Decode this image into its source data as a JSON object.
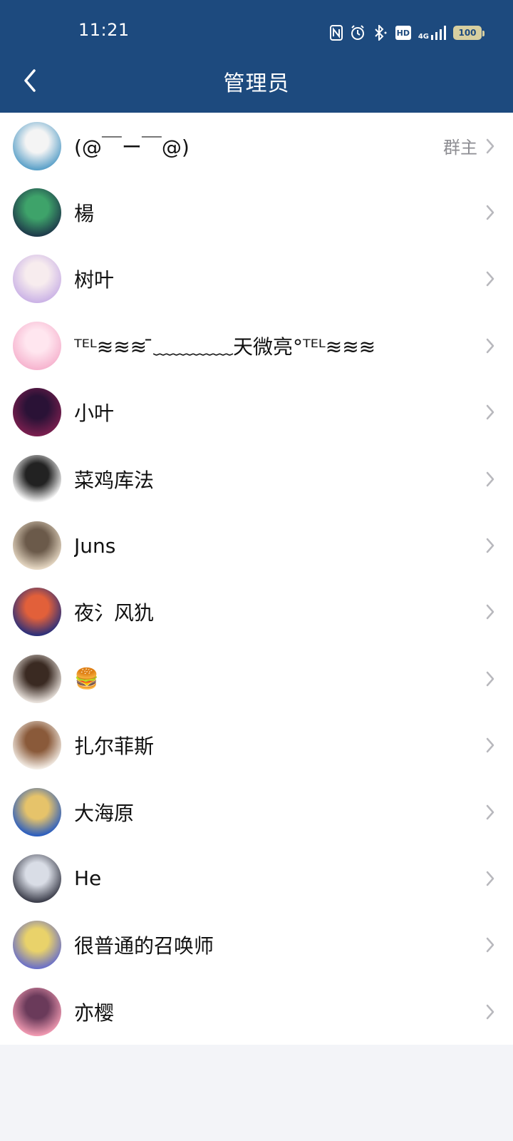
{
  "status_bar": {
    "time": "11:21",
    "network": "4G",
    "battery": "100",
    "icons": [
      "nfc-icon",
      "alarm-icon",
      "bluetooth-icon",
      "hd-icon",
      "signal-icon",
      "battery-icon"
    ]
  },
  "header": {
    "title": "管理员",
    "back_icon": "chevron-left-icon",
    "background": "#1d4a7e"
  },
  "members": [
    {
      "name": "(@￣ー￣@)",
      "role": "群主",
      "avatar_colors": [
        "#5aa0c8",
        "#f4f4f4"
      ]
    },
    {
      "name": "楊",
      "role": "",
      "avatar_colors": [
        "#1e3a4a",
        "#3ea36a"
      ]
    },
    {
      "name": "树叶",
      "role": "",
      "avatar_colors": [
        "#cbb3e6",
        "#f7ecee"
      ]
    },
    {
      "name": "ᵀᴱᴸ≋≋≋ ̄﹏﹏﹏﹏天微亮°ᵀᴱᴸ≋≋≋",
      "role": "",
      "avatar_colors": [
        "#f6b4cf",
        "#ffe6ef"
      ]
    },
    {
      "name": "小叶",
      "role": "",
      "avatar_colors": [
        "#7a1f4f",
        "#2a1236"
      ]
    },
    {
      "name": "菜鸡库法",
      "role": "",
      "avatar_colors": [
        "#ffffff",
        "#222222"
      ]
    },
    {
      "name": "Juns",
      "role": "",
      "avatar_colors": [
        "#e7d9c4",
        "#6b5a4a"
      ]
    },
    {
      "name": "夜氵风犰",
      "role": "",
      "avatar_colors": [
        "#2b2f7a",
        "#e2603a"
      ]
    },
    {
      "name": "🍔",
      "role": "",
      "avatar_colors": [
        "#e9e2dc",
        "#3a2a22"
      ]
    },
    {
      "name": "扎尔菲斯",
      "role": "",
      "avatar_colors": [
        "#f3ece4",
        "#8a5a3a"
      ]
    },
    {
      "name": "大海原",
      "role": "",
      "avatar_colors": [
        "#2a5dbf",
        "#e6c36a"
      ]
    },
    {
      "name": "He",
      "role": "",
      "avatar_colors": [
        "#3b3d4a",
        "#d9dde6"
      ]
    },
    {
      "name": "很普通的召唤师",
      "role": "",
      "avatar_colors": [
        "#6a6fc8",
        "#e9d26a"
      ]
    },
    {
      "name": "亦樱",
      "role": "",
      "avatar_colors": [
        "#f19ab2",
        "#6a3a5a"
      ]
    }
  ]
}
